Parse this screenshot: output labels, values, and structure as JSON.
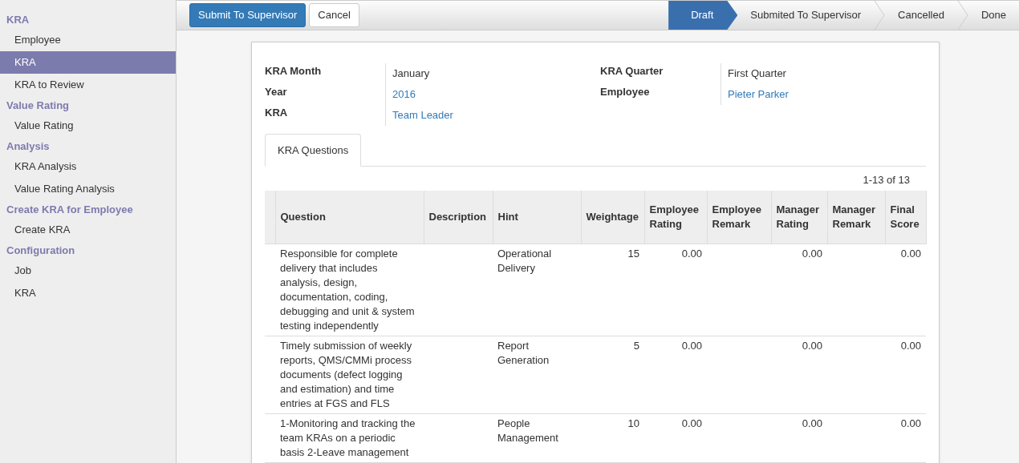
{
  "sidebar": {
    "sections": [
      {
        "title": "KRA",
        "items": [
          {
            "label": "Employee",
            "selected": false
          },
          {
            "label": "KRA",
            "selected": true
          },
          {
            "label": "KRA to Review",
            "selected": false
          }
        ]
      },
      {
        "title": "Value Rating",
        "items": [
          {
            "label": "Value Rating",
            "selected": false
          }
        ]
      },
      {
        "title": "Analysis",
        "items": [
          {
            "label": "KRA Analysis",
            "selected": false
          },
          {
            "label": "Value Rating Analysis",
            "selected": false
          }
        ]
      },
      {
        "title": "Create KRA for Employee",
        "items": [
          {
            "label": "Create KRA",
            "selected": false
          }
        ]
      },
      {
        "title": "Configuration",
        "items": [
          {
            "label": "Job",
            "selected": false
          },
          {
            "label": "KRA",
            "selected": false
          }
        ]
      }
    ]
  },
  "toolbar": {
    "buttons": [
      {
        "label": "Submit To Supervisor",
        "kind": "primary"
      },
      {
        "label": "Cancel",
        "kind": "default"
      }
    ],
    "statuses": [
      {
        "label": "Draft",
        "selected": true
      },
      {
        "label": "Submited To Supervisor",
        "selected": false
      },
      {
        "label": "Cancelled",
        "selected": false
      },
      {
        "label": "Done",
        "selected": false
      }
    ]
  },
  "form": {
    "left_fields": [
      {
        "label": "KRA Month",
        "value": "January",
        "kind": "text"
      },
      {
        "label": "Year",
        "value": "2016",
        "kind": "link"
      },
      {
        "label": "KRA",
        "value": "Team Leader",
        "kind": "link"
      }
    ],
    "right_fields": [
      {
        "label": "KRA Quarter",
        "value": "First Quarter",
        "kind": "text"
      },
      {
        "label": "Employee",
        "value": "Pieter Parker",
        "kind": "link"
      }
    ],
    "tabs": [
      {
        "label": "KRA Questions",
        "selected": true
      }
    ],
    "pager": "1-13 of 13",
    "table": {
      "columns": [
        "Question",
        "Description",
        "Hint",
        "Weightage",
        "Employee Rating",
        "Employee Remark",
        "Manager Rating",
        "Manager Remark",
        "Final Score"
      ],
      "rows": [
        [
          "Responsible for complete delivery that includes analysis, design, documentation, coding, debugging and unit & system testing independently",
          "",
          "Operational Delivery",
          "15",
          "0.00",
          "",
          "0.00",
          "",
          "0.00"
        ],
        [
          "Timely submission of weekly reports, QMS/CMMi process documents (defect logging and estimation) and time entries at FGS and FLS",
          "",
          "Report Generation",
          "5",
          "0.00",
          "",
          "0.00",
          "",
          "0.00"
        ],
        [
          "1-Monitoring and tracking the team KRAs on a periodic basis 2-Leave management",
          "",
          "People Management",
          "10",
          "0.00",
          "",
          "0.00",
          "",
          "0.00"
        ]
      ]
    }
  }
}
